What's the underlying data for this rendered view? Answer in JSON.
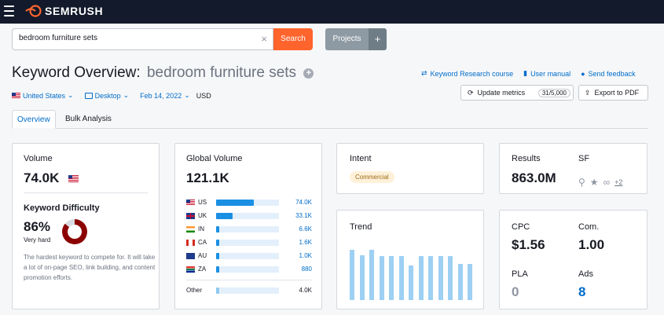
{
  "app": {
    "name": "SEMRUSH"
  },
  "search": {
    "value": "bedroom furniture sets",
    "button": "Search"
  },
  "projects": {
    "label": "Projects",
    "plus": "+"
  },
  "header": {
    "title": "Keyword Overview:",
    "keyword": "bedroom furniture sets",
    "links": [
      "Keyword Research course",
      "User manual",
      "Send feedback"
    ]
  },
  "filters": {
    "database": "United States",
    "device": "Desktop",
    "date": "Feb 14, 2022",
    "currency": "USD"
  },
  "actions": {
    "update": "Update metrics",
    "update_count": "31/5,000",
    "export": "Export to PDF"
  },
  "tabs": [
    "Overview",
    "Bulk Analysis"
  ],
  "volume": {
    "label": "Volume",
    "value": "74.0K"
  },
  "kd": {
    "label": "Keyword Difficulty",
    "value": "86%",
    "level": "Very hard",
    "percent": 86,
    "description": "The hardest keyword to compete for. It will take a lot of on-page SEO, link building, and content promotion efforts."
  },
  "global_volume": {
    "label": "Global Volume",
    "value": "121.1K",
    "rows": [
      {
        "code": "US",
        "value": "74.0K",
        "share": 0.61
      },
      {
        "code": "UK",
        "value": "33.1K",
        "share": 0.27
      },
      {
        "code": "IN",
        "value": "6.6K",
        "share": 0.05
      },
      {
        "code": "CA",
        "value": "1.6K",
        "share": 0.03
      },
      {
        "code": "AU",
        "value": "1.0K",
        "share": 0.03
      },
      {
        "code": "ZA",
        "value": "880",
        "share": 0.03
      }
    ],
    "other": {
      "label": "Other",
      "value": "4.0K",
      "share": 0.04
    }
  },
  "intent": {
    "label": "Intent",
    "value": "Commercial"
  },
  "trend": {
    "label": "Trend",
    "values": [
      0.97,
      0.87,
      0.97,
      0.85,
      0.85,
      0.85,
      0.66,
      0.85,
      0.85,
      0.85,
      0.85,
      0.69,
      0.69
    ]
  },
  "results": {
    "label": "Results",
    "value": "863.0M"
  },
  "sf": {
    "label": "SF",
    "more": "+2"
  },
  "cpc": {
    "label": "CPC",
    "value": "$1.56"
  },
  "com": {
    "label": "Com.",
    "value": "1.00"
  },
  "pla": {
    "label": "PLA",
    "value": "0"
  },
  "ads": {
    "label": "Ads",
    "value": "8"
  },
  "colors": {
    "brand": "#ff642d",
    "link": "#006dca",
    "kd": "#8b0000",
    "bar": "#1a8fe3"
  }
}
